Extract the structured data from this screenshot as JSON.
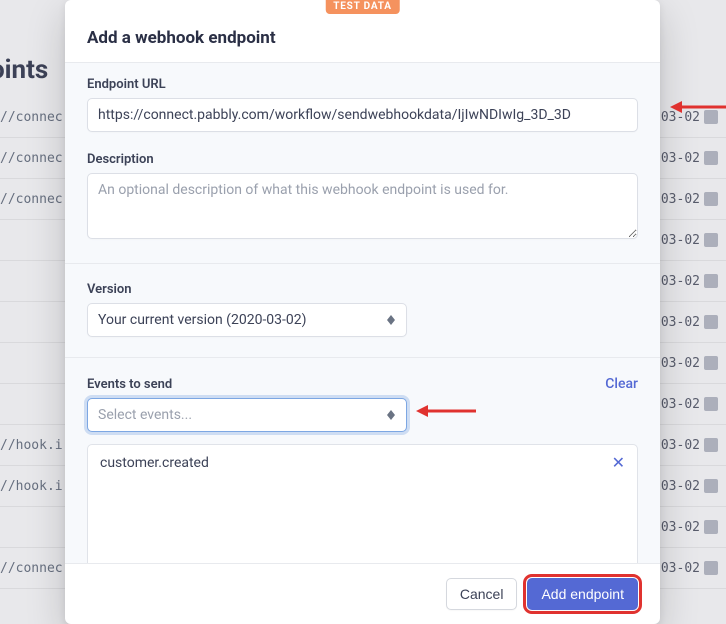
{
  "badge": "TEST DATA",
  "bg": {
    "heading": "oints",
    "rows": [
      {
        "url": "//connec",
        "date": "-03-02"
      },
      {
        "url": "//connec",
        "date": "-03-02"
      },
      {
        "url": "//connec",
        "date": "-03-02"
      },
      {
        "url": "",
        "date": "-03-02"
      },
      {
        "url": "",
        "date": "-03-02"
      },
      {
        "url": "",
        "date": "-03-02"
      },
      {
        "url": "",
        "date": "-03-02"
      },
      {
        "url": "",
        "date": "-03-02"
      },
      {
        "url": "//hook.i",
        "date": "-03-02"
      },
      {
        "url": "//hook.i",
        "date": "-03-02"
      },
      {
        "url": "",
        "date": "-03-02"
      },
      {
        "url": "//connec",
        "date": "-03-02"
      }
    ]
  },
  "modal": {
    "title": "Add a webhook endpoint",
    "url": {
      "label": "Endpoint URL",
      "value": "https://connect.pabbly.com/workflow/sendwebhookdata/IjIwNDIwIg_3D_3D"
    },
    "description": {
      "label": "Description",
      "placeholder": "An optional description of what this webhook endpoint is used for."
    },
    "version": {
      "label": "Version",
      "value": "Your current version (2020-03-02)"
    },
    "events": {
      "label": "Events to send",
      "placeholder": "Select events...",
      "clear": "Clear",
      "selected": [
        "customer.created"
      ]
    },
    "footer": {
      "cancel": "Cancel",
      "submit": "Add endpoint"
    }
  }
}
